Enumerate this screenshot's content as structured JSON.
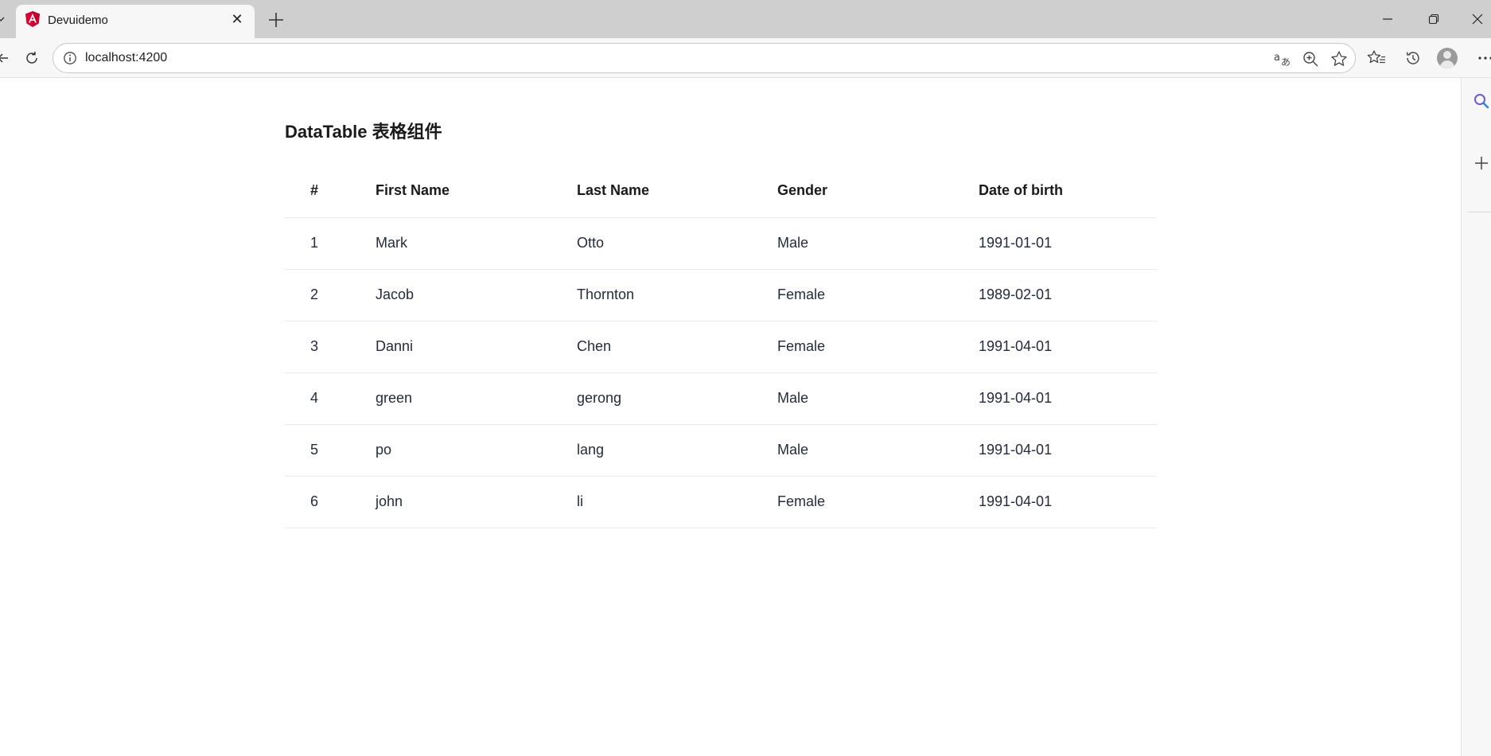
{
  "browser": {
    "tab": {
      "title": "Devuidemo",
      "close_glyph": "✕"
    },
    "address": {
      "url": "localhost:4200"
    },
    "icons": {
      "tab_favicon": "angular-icon",
      "new_tab": "plus-icon",
      "refresh": "refresh-icon",
      "site_info": "info-icon",
      "translate": "translate-icon",
      "zoom": "zoom-in-icon",
      "favorite": "star-icon",
      "favorites_bar": "favorites-icon",
      "history": "history-icon",
      "profile": "avatar",
      "menu": "more-icon",
      "sidebar_search": "search-icon",
      "sidebar_add": "plus-icon"
    },
    "colors": {
      "angular_red": "#dd0031",
      "angular_pink": "#c3002f",
      "tabstrip": "#cfcfcf"
    }
  },
  "page": {
    "title": "DataTable 表格组件",
    "table": {
      "headers": [
        "#",
        "First Name",
        "Last Name",
        "Gender",
        "Date of birth"
      ],
      "rows": [
        [
          "1",
          "Mark",
          "Otto",
          "Male",
          "1991-01-01"
        ],
        [
          "2",
          "Jacob",
          "Thornton",
          "Female",
          "1989-02-01"
        ],
        [
          "3",
          "Danni",
          "Chen",
          "Female",
          "1991-04-01"
        ],
        [
          "4",
          "green",
          "gerong",
          "Male",
          "1991-04-01"
        ],
        [
          "5",
          "po",
          "lang",
          "Male",
          "1991-04-01"
        ],
        [
          "6",
          "john",
          "li",
          "Female",
          "1991-04-01"
        ]
      ]
    }
  }
}
